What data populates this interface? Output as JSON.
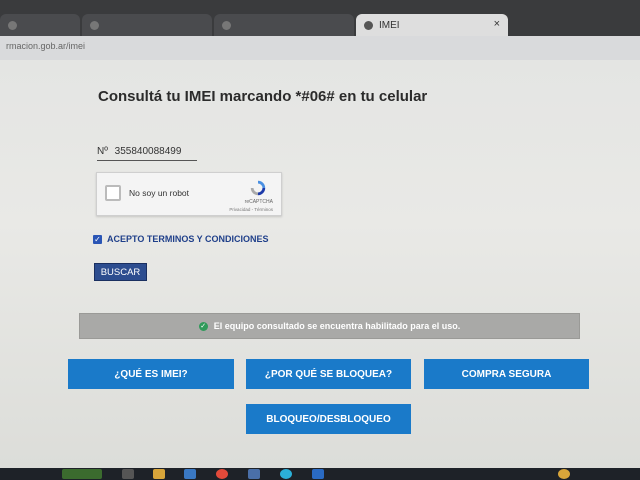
{
  "browser": {
    "tabs": [
      {
        "label": ""
      },
      {
        "label": ""
      },
      {
        "label": ""
      },
      {
        "label": "IMEI",
        "close": "×"
      }
    ],
    "url": "rmacion.gob.ar/imei"
  },
  "page": {
    "title": "Consultá tu IMEI marcando *#06# en tu celular",
    "imei_prefix": "Nº",
    "imei_value": "355840088499",
    "captcha": {
      "label": "No soy un robot",
      "brand": "reCAPTCHA",
      "privacy": "Privacidad - Términos"
    },
    "terms_label": "ACEPTO TERMINOS Y CONDICIONES",
    "terms_checked": true,
    "search_label": "BUSCAR",
    "status_message": "El equipo consultado se encuentra habilitado para el uso.",
    "status_color": "#2f9a5a",
    "buttons": {
      "que_es": "¿QUÉ ES IMEI?",
      "por_que": "¿POR QUÉ SE BLOQUEA?",
      "compra": "COMPRA SEGURA",
      "bloqueo": "BLOQUEO/DESBLOQUEO"
    },
    "accent_color": "#1a7ac9"
  }
}
